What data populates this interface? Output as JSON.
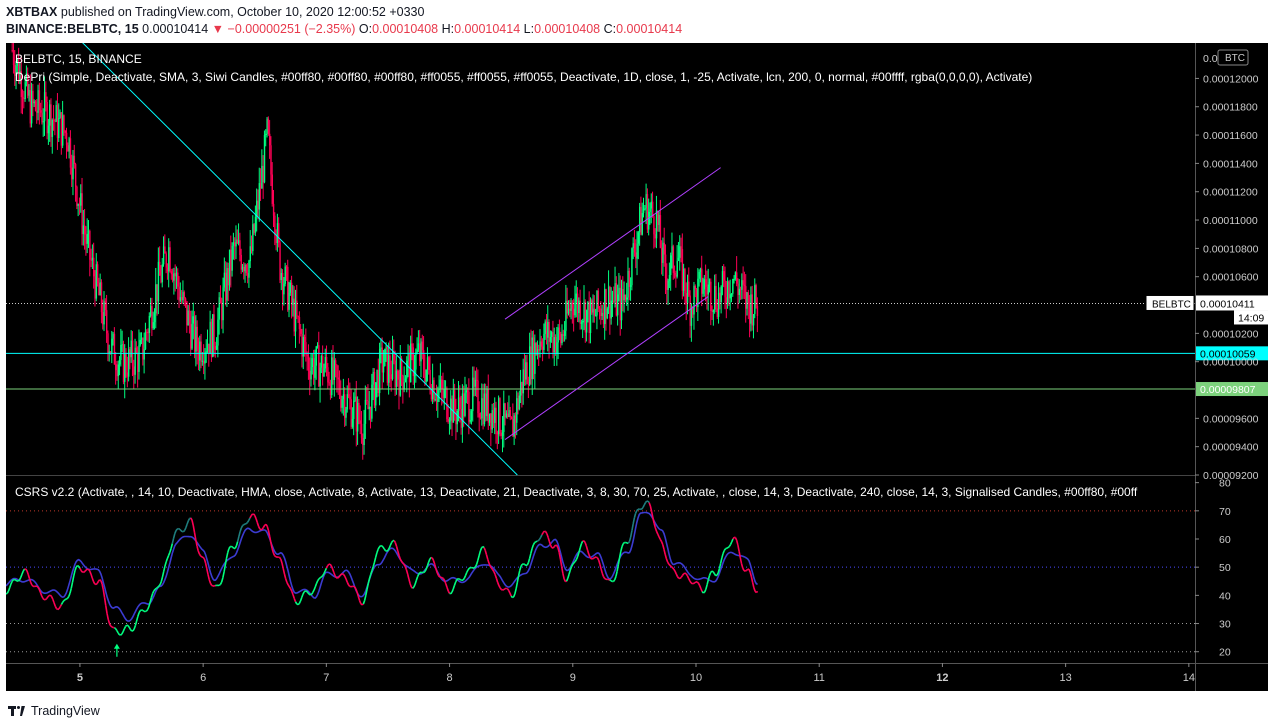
{
  "header": {
    "line1_user": "XBTBAX",
    "line1_rest": " published on TradingView.com, October 10, 2020 12:00:52 +0330",
    "symbol": "BINANCE:BELBTC, 15",
    "last": "0.00010414",
    "change": "▼ −0.00000251 (−2.35%)",
    "o_label": "O:",
    "o": "0.00010408",
    "h_label": "H:",
    "h": "0.00010414",
    "l_label": "L:",
    "l": "0.00010408",
    "c_label": "C:",
    "c": "0.00010414"
  },
  "footer": {
    "brand": "TradingView"
  },
  "colors": {
    "up": "#00ff80",
    "down": "#ff0055",
    "cyan": "#00ffff",
    "channel": "#b040ff",
    "hline": "#00ffff",
    "hline2": "#7dd27d"
  },
  "chart_data": [
    {
      "type": "candlestick",
      "title": "BELBTC, 15, BINANCE",
      "indicator_label": "DePri (Simple, Deactivate, SMA, 3, Siwi Candles, #00ff80, #00ff80, #00ff80, #ff0055, #ff0055, #ff0055, Deactivate, 1D, close, 1, -25, Activate, lcn, 200, 0, normal, #00ffff, rgba(0,0,0,0), Activate)",
      "currency_badge": "BTC",
      "ylim": [
        9.2e-05,
        0.0001225
      ],
      "y_ticks": [
        "0.00012000",
        "0.00011800",
        "0.00011600",
        "0.00011400",
        "0.00011200",
        "0.00011000",
        "0.00010800",
        "0.00010600",
        "0.00010200",
        "0.00010000",
        "0.00009600",
        "0.00009400",
        "0.00009200"
      ],
      "y_tick_values": [
        0.00012,
        0.000118,
        0.000116,
        0.000114,
        0.000112,
        0.00011,
        0.000108,
        0.000106,
        0.000102,
        0.0001,
        9.6e-05,
        9.4e-05,
        9.2e-05
      ],
      "top_tick_partial": "0.0 200",
      "x_ticks": [
        "5",
        "6",
        "7",
        "8",
        "9",
        "10",
        "11",
        "12",
        "13",
        "14"
      ],
      "x_tick_bold": [
        "5",
        "12"
      ],
      "xlim": [
        4.4,
        14.05
      ],
      "price_path": [
        [
          4.45,
          0.000122
        ],
        [
          4.6,
          0.000118
        ],
        [
          4.75,
          0.0001175
        ],
        [
          4.9,
          0.000116
        ],
        [
          5.05,
          0.0001085
        ],
        [
          5.25,
          0.000101
        ],
        [
          5.35,
          9.98e-05
        ],
        [
          5.5,
          0.0001005
        ],
        [
          5.6,
          0.0001045
        ],
        [
          5.72,
          0.000108
        ],
        [
          5.82,
          0.0001045
        ],
        [
          5.95,
          0.000101
        ],
        [
          6.1,
          0.000102
        ],
        [
          6.25,
          0.000108
        ],
        [
          6.38,
          0.000107
        ],
        [
          6.52,
          0.000116
        ],
        [
          6.62,
          0.000107
        ],
        [
          6.75,
          0.000103
        ],
        [
          6.85,
          0.0001
        ],
        [
          7.0,
          9.95e-05
        ],
        [
          7.15,
          9.75e-05
        ],
        [
          7.3,
          9.55e-05
        ],
        [
          7.45,
          0.0001
        ],
        [
          7.6,
          9.9e-05
        ],
        [
          7.75,
          0.0001005
        ],
        [
          7.9,
          9.8e-05
        ],
        [
          8.05,
          9.65e-05
        ],
        [
          8.2,
          9.75e-05
        ],
        [
          8.35,
          9.65e-05
        ],
        [
          8.5,
          9.5e-05
        ],
        [
          8.6,
          9.9e-05
        ],
        [
          8.75,
          0.000102
        ],
        [
          8.9,
          0.0001015
        ],
        [
          9.0,
          0.0001045
        ],
        [
          9.15,
          0.000103
        ],
        [
          9.28,
          0.0001045
        ],
        [
          9.4,
          0.000104
        ],
        [
          9.5,
          0.000108
        ],
        [
          9.58,
          0.000111
        ],
        [
          9.68,
          0.00011
        ],
        [
          9.75,
          0.000106
        ],
        [
          9.85,
          0.0001075
        ],
        [
          9.95,
          0.000104
        ],
        [
          10.05,
          0.0001055
        ],
        [
          10.18,
          0.0001045
        ],
        [
          10.3,
          0.000106
        ],
        [
          10.42,
          0.000104
        ],
        [
          10.5,
          0.0001041
        ]
      ],
      "trendline": {
        "from": [
          4.85,
          0.000124
        ],
        "to": [
          8.55,
          9.2e-05
        ]
      },
      "channel_upper": {
        "from": [
          8.45,
          0.000103
        ],
        "to": [
          10.2,
          0.0001137
        ]
      },
      "channel_lower": {
        "from": [
          8.45,
          9.45e-05
        ],
        "to": [
          10.1,
          0.0001046
        ]
      },
      "horizontal_levels": [
        {
          "value": 0.00010059,
          "label": "0.00010059",
          "color": "#00ffff"
        },
        {
          "value": 9.807e-05,
          "label": "0.00009807",
          "color": "#7dd27d"
        }
      ],
      "last_price": {
        "value": 0.00010411,
        "label": "0.00010411",
        "symbol_tag": "BELBTC",
        "countdown": "14:09"
      }
    },
    {
      "type": "line",
      "title": "CSRS v2.2",
      "indicator_label": "CSRS v2.2 (Activate, , 14, 10, Deactivate, HMA, close, Activate, 8, Activate, 13, Deactivate, 21, Deactivate, 3, 8, 30, 70, 25, Activate, , close, 14, 3, Deactivate, 240, close, 14, 3, Signalised Candles, #00ff80, #00ff",
      "ylim": [
        16,
        82
      ],
      "y_ticks": [
        "80",
        "70",
        "60",
        "50",
        "40",
        "30",
        "20"
      ],
      "y_tick_values": [
        80,
        70,
        60,
        50,
        40,
        30,
        20
      ],
      "levels": [
        70,
        50,
        30,
        20
      ],
      "series": [
        {
          "values": [
            [
              4.4,
              42
            ],
            [
              4.55,
              48
            ],
            [
              4.7,
              40
            ],
            [
              4.85,
              36
            ],
            [
              5.0,
              50
            ],
            [
              5.15,
              45
            ],
            [
              5.28,
              27
            ],
            [
              5.4,
              28
            ],
            [
              5.55,
              36
            ],
            [
              5.65,
              45
            ],
            [
              5.78,
              62
            ],
            [
              5.9,
              66
            ],
            [
              6.0,
              52
            ],
            [
              6.1,
              42
            ],
            [
              6.25,
              58
            ],
            [
              6.38,
              68
            ],
            [
              6.5,
              64
            ],
            [
              6.62,
              52
            ],
            [
              6.75,
              38
            ],
            [
              6.9,
              42
            ],
            [
              7.0,
              50
            ],
            [
              7.15,
              46
            ],
            [
              7.3,
              38
            ],
            [
              7.42,
              56
            ],
            [
              7.55,
              58
            ],
            [
              7.7,
              44
            ],
            [
              7.85,
              52
            ],
            [
              8.0,
              42
            ],
            [
              8.15,
              48
            ],
            [
              8.28,
              56
            ],
            [
              8.4,
              44
            ],
            [
              8.5,
              40
            ],
            [
              8.62,
              52
            ],
            [
              8.75,
              62
            ],
            [
              8.85,
              58
            ],
            [
              8.95,
              46
            ],
            [
              9.08,
              58
            ],
            [
              9.2,
              52
            ],
            [
              9.3,
              44
            ],
            [
              9.45,
              60
            ],
            [
              9.55,
              72
            ],
            [
              9.62,
              72
            ],
            [
              9.72,
              58
            ],
            [
              9.82,
              48
            ],
            [
              9.95,
              46
            ],
            [
              10.05,
              42
            ],
            [
              10.15,
              48
            ],
            [
              10.3,
              60
            ],
            [
              10.42,
              48
            ],
            [
              10.5,
              42
            ]
          ]
        },
        {
          "values": [
            [
              4.4,
              44
            ],
            [
              4.55,
              46
            ],
            [
              4.7,
              42
            ],
            [
              4.85,
              40
            ],
            [
              5.0,
              52
            ],
            [
              5.15,
              48
            ],
            [
              5.28,
              35
            ],
            [
              5.4,
              32
            ],
            [
              5.55,
              38
            ],
            [
              5.65,
              42
            ],
            [
              5.78,
              58
            ],
            [
              5.9,
              62
            ],
            [
              6.0,
              55
            ],
            [
              6.1,
              46
            ],
            [
              6.25,
              55
            ],
            [
              6.38,
              64
            ],
            [
              6.5,
              62
            ],
            [
              6.62,
              55
            ],
            [
              6.75,
              42
            ],
            [
              6.9,
              40
            ],
            [
              7.0,
              47
            ],
            [
              7.15,
              48
            ],
            [
              7.3,
              40
            ],
            [
              7.42,
              52
            ],
            [
              7.55,
              56
            ],
            [
              7.7,
              48
            ],
            [
              7.85,
              50
            ],
            [
              8.0,
              45
            ],
            [
              8.15,
              46
            ],
            [
              8.28,
              52
            ],
            [
              8.4,
              47
            ],
            [
              8.5,
              43
            ],
            [
              8.62,
              49
            ],
            [
              8.75,
              58
            ],
            [
              8.85,
              59
            ],
            [
              8.95,
              50
            ],
            [
              9.08,
              55
            ],
            [
              9.2,
              54
            ],
            [
              9.3,
              47
            ],
            [
              9.45,
              56
            ],
            [
              9.55,
              68
            ],
            [
              9.62,
              70
            ],
            [
              9.72,
              62
            ],
            [
              9.82,
              52
            ],
            [
              9.95,
              48
            ],
            [
              10.05,
              45
            ],
            [
              10.15,
              46
            ],
            [
              10.3,
              56
            ],
            [
              10.42,
              52
            ],
            [
              10.5,
              45
            ]
          ]
        }
      ],
      "arrow_marker": {
        "x": 5.3,
        "value": 20
      }
    }
  ]
}
